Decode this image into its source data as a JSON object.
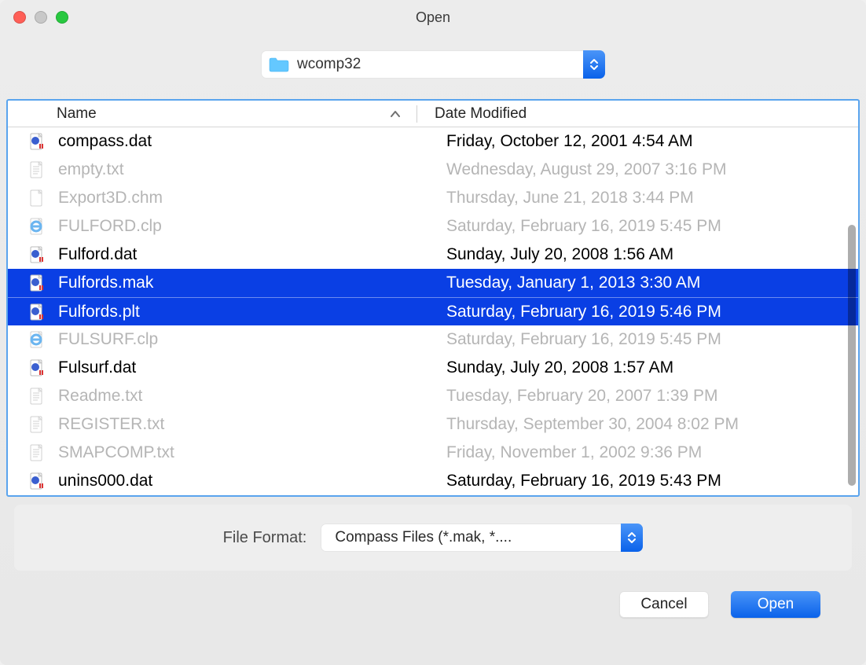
{
  "window": {
    "title": "Open"
  },
  "path": {
    "folder": "wcomp32"
  },
  "columns": {
    "name": "Name",
    "date": "Date Modified"
  },
  "files": [
    {
      "name": "compass.dat",
      "date": "Friday, October 12, 2001 4:54 AM",
      "enabled": true,
      "selected": false,
      "icon": "dat"
    },
    {
      "name": "empty.txt",
      "date": "Wednesday, August 29, 2007 3:16 PM",
      "enabled": false,
      "selected": false,
      "icon": "txt"
    },
    {
      "name": "Export3D.chm",
      "date": "Thursday, June 21, 2018 3:44 PM",
      "enabled": false,
      "selected": false,
      "icon": "blank"
    },
    {
      "name": "FULFORD.clp",
      "date": "Saturday, February 16, 2019 5:45 PM",
      "enabled": false,
      "selected": false,
      "icon": "clp"
    },
    {
      "name": "Fulford.dat",
      "date": "Sunday, July 20, 2008 1:56 AM",
      "enabled": true,
      "selected": false,
      "icon": "dat"
    },
    {
      "name": "Fulfords.mak",
      "date": "Tuesday, January 1, 2013 3:30 AM",
      "enabled": true,
      "selected": true,
      "icon": "dat"
    },
    {
      "name": "Fulfords.plt",
      "date": "Saturday, February 16, 2019 5:46 PM",
      "enabled": true,
      "selected": true,
      "icon": "dat"
    },
    {
      "name": "FULSURF.clp",
      "date": "Saturday, February 16, 2019 5:45 PM",
      "enabled": false,
      "selected": false,
      "icon": "clp"
    },
    {
      "name": "Fulsurf.dat",
      "date": "Sunday, July 20, 2008 1:57 AM",
      "enabled": true,
      "selected": false,
      "icon": "dat"
    },
    {
      "name": "Readme.txt",
      "date": "Tuesday, February 20, 2007 1:39 PM",
      "enabled": false,
      "selected": false,
      "icon": "txt"
    },
    {
      "name": "REGISTER.txt",
      "date": "Thursday, September 30, 2004 8:02 PM",
      "enabled": false,
      "selected": false,
      "icon": "txt"
    },
    {
      "name": "SMAPCOMP.txt",
      "date": "Friday, November 1, 2002 9:36 PM",
      "enabled": false,
      "selected": false,
      "icon": "txt"
    },
    {
      "name": "unins000.dat",
      "date": "Saturday, February 16, 2019 5:43 PM",
      "enabled": true,
      "selected": false,
      "icon": "dat"
    }
  ],
  "filter": {
    "label": "File Format:",
    "value": "Compass Files (*.mak, *...."
  },
  "actions": {
    "cancel": "Cancel",
    "open": "Open"
  }
}
